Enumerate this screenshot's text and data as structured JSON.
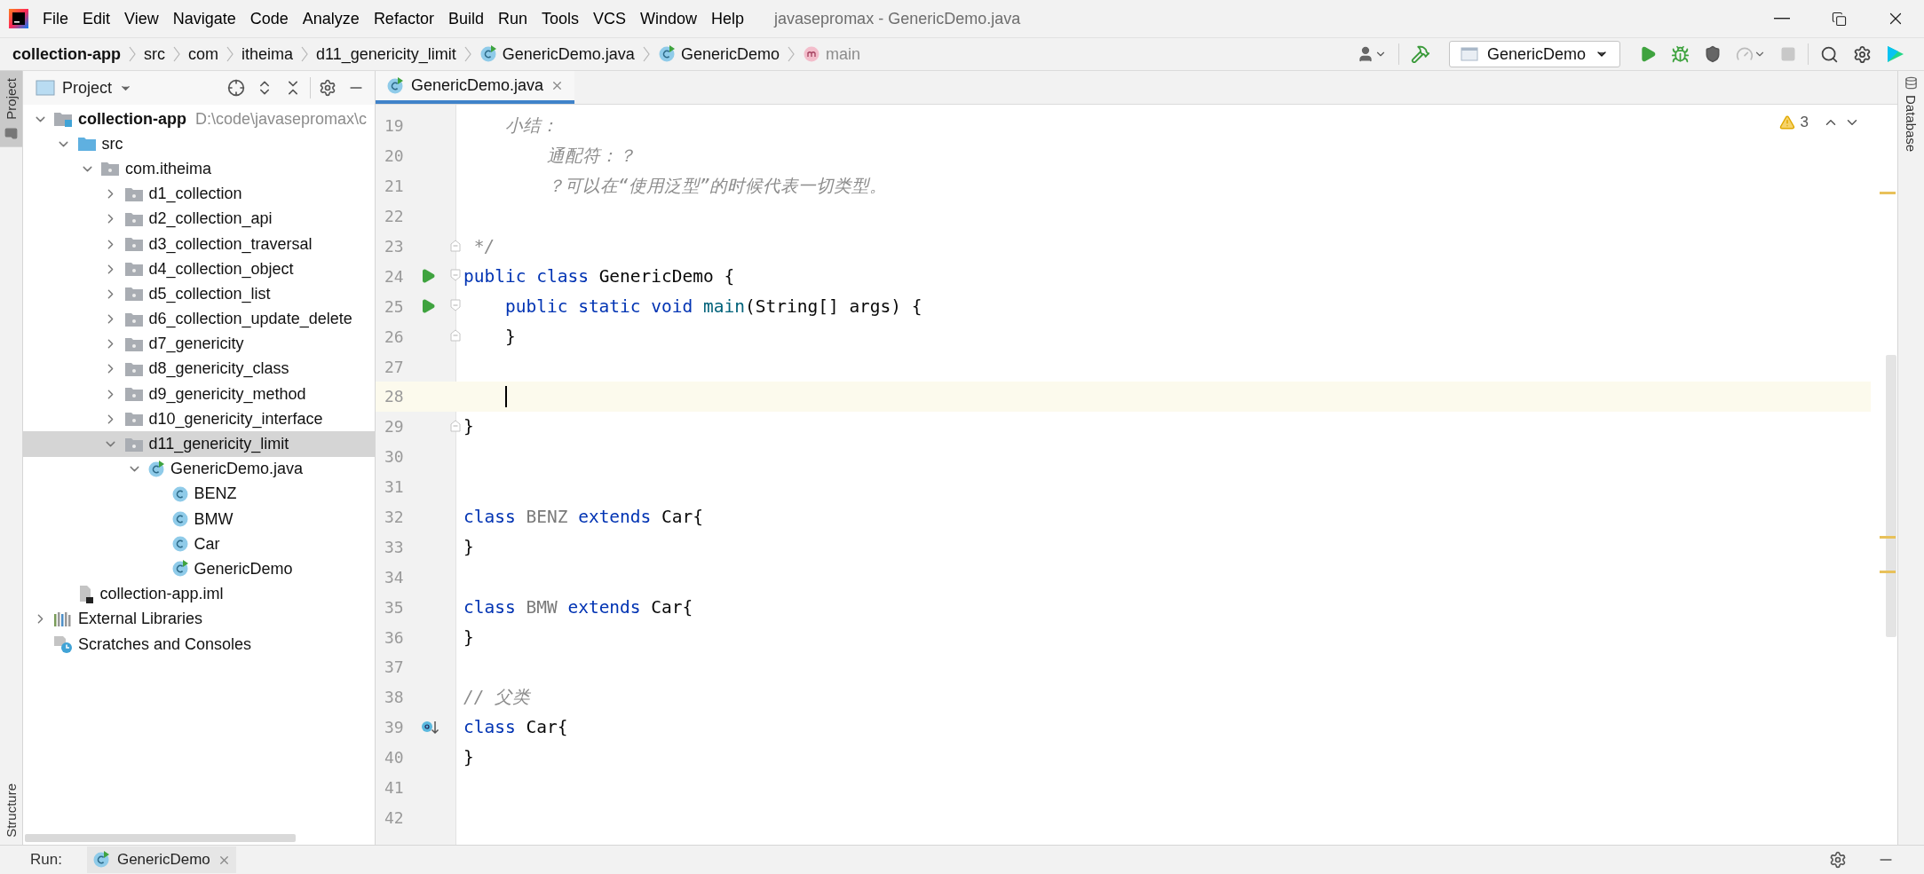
{
  "window": {
    "title": "javasepromax - GenericDemo.java"
  },
  "menu": [
    "File",
    "Edit",
    "View",
    "Navigate",
    "Code",
    "Analyze",
    "Refactor",
    "Build",
    "Run",
    "Tools",
    "VCS",
    "Window",
    "Help"
  ],
  "breadcrumbs": [
    {
      "label": "collection-app",
      "kind": "module"
    },
    {
      "label": "src",
      "kind": "folder"
    },
    {
      "label": "com",
      "kind": "folder"
    },
    {
      "label": "itheima",
      "kind": "folder"
    },
    {
      "label": "d11_genericity_limit",
      "kind": "folder"
    },
    {
      "label": "GenericDemo.java",
      "kind": "file"
    },
    {
      "label": "GenericDemo",
      "kind": "class"
    },
    {
      "label": "main",
      "kind": "method"
    }
  ],
  "run_config": "GenericDemo",
  "left_stripe": [
    {
      "label": "Project",
      "selected": true
    },
    {
      "label": "Structure",
      "selected": false
    }
  ],
  "project": {
    "title": "Project",
    "tree": [
      {
        "label": "collection-app",
        "kind": "module",
        "hint": "D:\\code\\javasepromax\\c",
        "expanded": true,
        "selected": false,
        "children": [
          {
            "label": "src",
            "kind": "source",
            "expanded": true,
            "selected": false,
            "children": [
              {
                "label": "com.itheima",
                "kind": "package",
                "expanded": true,
                "selected": false,
                "children": [
                  {
                    "label": "d1_collection",
                    "kind": "package",
                    "expanded": false,
                    "selected": false
                  },
                  {
                    "label": "d2_collection_api",
                    "kind": "package",
                    "expanded": false,
                    "selected": false
                  },
                  {
                    "label": "d3_collection_traversal",
                    "kind": "package",
                    "expanded": false,
                    "selected": false
                  },
                  {
                    "label": "d4_collection_object",
                    "kind": "package",
                    "expanded": false,
                    "selected": false
                  },
                  {
                    "label": "d5_collection_list",
                    "kind": "package",
                    "expanded": false,
                    "selected": false
                  },
                  {
                    "label": "d6_collection_update_delete",
                    "kind": "package",
                    "expanded": false,
                    "selected": false
                  },
                  {
                    "label": "d7_genericity",
                    "kind": "package",
                    "expanded": false,
                    "selected": false
                  },
                  {
                    "label": "d8_genericity_class",
                    "kind": "package",
                    "expanded": false,
                    "selected": false
                  },
                  {
                    "label": "d9_genericity_method",
                    "kind": "package",
                    "expanded": false,
                    "selected": false
                  },
                  {
                    "label": "d10_genericity_interface",
                    "kind": "package",
                    "expanded": false,
                    "selected": false
                  },
                  {
                    "label": "d11_genericity_limit",
                    "kind": "package",
                    "expanded": true,
                    "selected": true,
                    "children": [
                      {
                        "label": "GenericDemo.java",
                        "kind": "runnable",
                        "expanded": true,
                        "selected": false,
                        "children": [
                          {
                            "label": "BENZ",
                            "kind": "class",
                            "selected": false
                          },
                          {
                            "label": "BMW",
                            "kind": "class",
                            "selected": false
                          },
                          {
                            "label": "Car",
                            "kind": "class",
                            "selected": false
                          },
                          {
                            "label": "GenericDemo",
                            "kind": "runnable",
                            "selected": false
                          }
                        ]
                      }
                    ]
                  }
                ]
              }
            ]
          },
          {
            "label": "collection-app.iml",
            "kind": "iml",
            "selected": false
          }
        ]
      },
      {
        "label": "External Libraries",
        "kind": "libraries",
        "expanded": false,
        "selected": false
      },
      {
        "label": "Scratches and Consoles",
        "kind": "scratches",
        "selected": false
      }
    ]
  },
  "editor": {
    "tabs": [
      {
        "label": "GenericDemo.java",
        "selected": true
      }
    ],
    "problems": "3",
    "lines": [
      {
        "number": "19",
        "code": [
          {
            "text": "    小结：",
            "kind": "comment"
          }
        ]
      },
      {
        "number": "20",
        "code": [
          {
            "text": "        通配符：？",
            "kind": "comment"
          }
        ]
      },
      {
        "number": "21",
        "code": [
          {
            "text": "        ？可以在“使用泛型”的时候代表一切类型。",
            "kind": "comment"
          }
        ]
      },
      {
        "number": "22"
      },
      {
        "number": "23",
        "fold_end": true,
        "code": [
          {
            "text": " */",
            "kind": "comment"
          }
        ]
      },
      {
        "number": "24",
        "run_marker": true,
        "fold_start": true,
        "code": [
          {
            "text": "public class",
            "kind": "keyword"
          },
          {
            "text": " GenericDemo {",
            "kind": "plain"
          }
        ]
      },
      {
        "number": "25",
        "run_marker": true,
        "fold_start": true,
        "code": [
          {
            "text": "    public static void",
            "kind": "keyword"
          },
          {
            "text": " main",
            "kind": "method"
          },
          {
            "text": "(String[] args) {",
            "kind": "plain"
          }
        ]
      },
      {
        "number": "26",
        "fold_end": true,
        "code": [
          {
            "text": "    }",
            "kind": "plain"
          }
        ]
      },
      {
        "number": "27"
      },
      {
        "number": "28",
        "current": true
      },
      {
        "number": "29",
        "fold_end": true,
        "code": [
          {
            "text": "}",
            "kind": "plain"
          }
        ]
      },
      {
        "number": "30"
      },
      {
        "number": "31"
      },
      {
        "number": "32",
        "code": [
          {
            "text": "class",
            "kind": "keyword"
          },
          {
            "text": " BENZ",
            "kind": "unused"
          },
          {
            "text": " extends",
            "kind": "keyword"
          },
          {
            "text": " Car{",
            "kind": "plain"
          }
        ]
      },
      {
        "number": "33",
        "code": [
          {
            "text": "}",
            "kind": "plain"
          }
        ]
      },
      {
        "number": "34"
      },
      {
        "number": "35",
        "code": [
          {
            "text": "class",
            "kind": "keyword"
          },
          {
            "text": " BMW",
            "kind": "unused"
          },
          {
            "text": " extends",
            "kind": "keyword"
          },
          {
            "text": " Car{",
            "kind": "plain"
          }
        ]
      },
      {
        "number": "36",
        "code": [
          {
            "text": "}",
            "kind": "plain"
          }
        ]
      },
      {
        "number": "37"
      },
      {
        "number": "38",
        "code": [
          {
            "text": "// 父类",
            "kind": "comment"
          }
        ]
      },
      {
        "number": "39",
        "implemented_marker": true,
        "code": [
          {
            "text": "class",
            "kind": "keyword"
          },
          {
            "text": " Car{",
            "kind": "plain"
          }
        ]
      },
      {
        "number": "40",
        "code": [
          {
            "text": "}",
            "kind": "plain"
          }
        ]
      },
      {
        "number": "41"
      },
      {
        "number": "42"
      }
    ]
  },
  "right_stripe": [
    {
      "label": "Database"
    }
  ],
  "run_panel": {
    "title": "Run:",
    "tabs": [
      {
        "label": "GenericDemo",
        "selected": true
      }
    ]
  }
}
